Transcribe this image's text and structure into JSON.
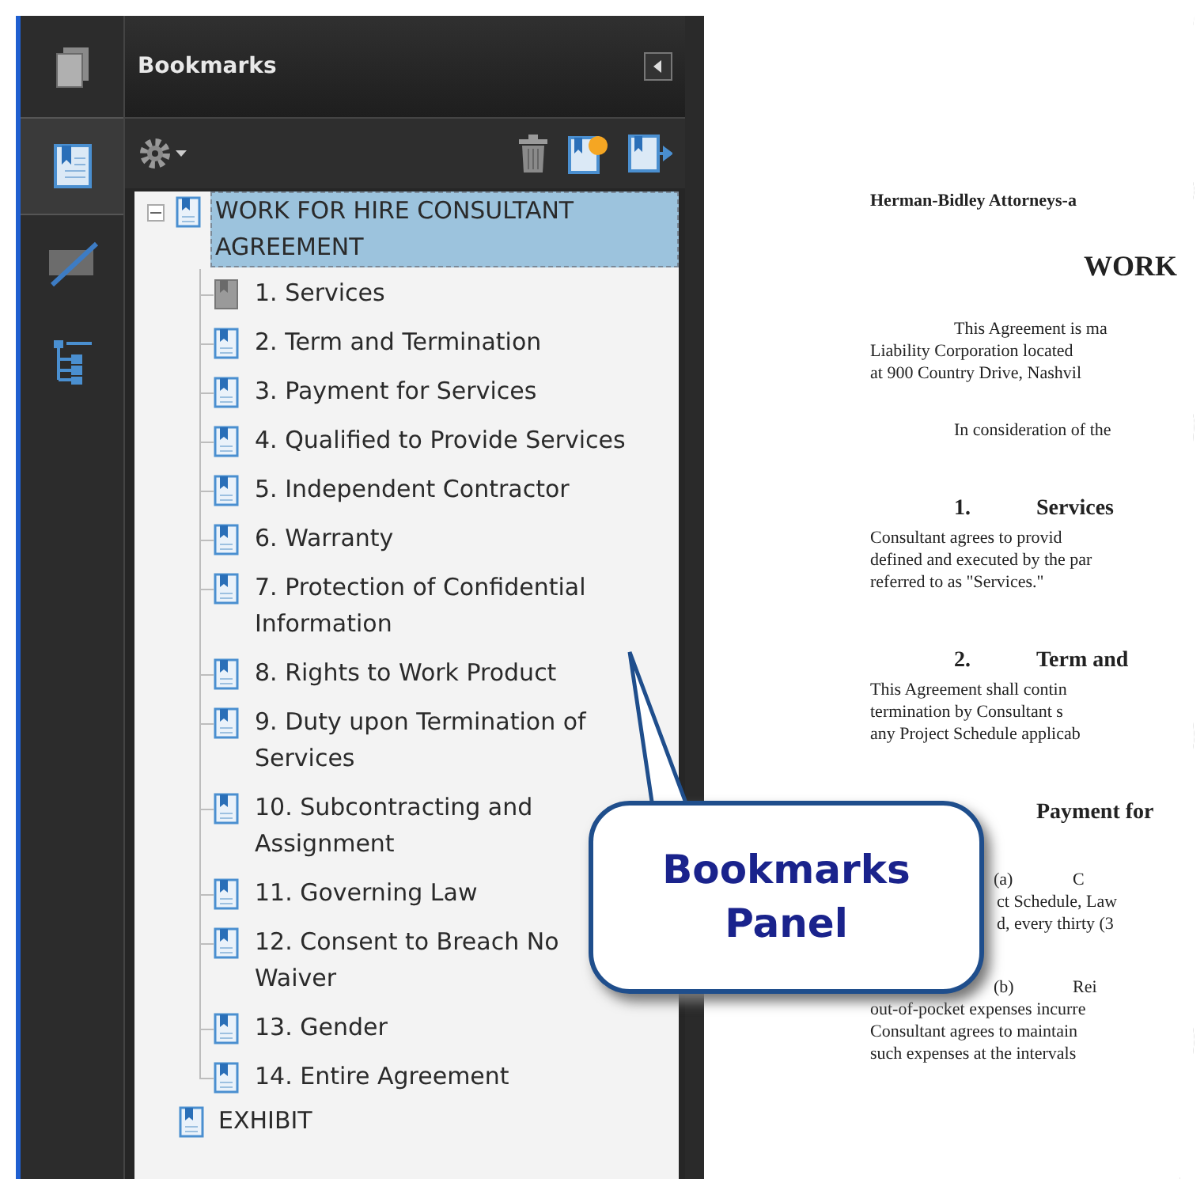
{
  "sidebar_tabs": [
    {
      "kind": "pages",
      "selected": false
    },
    {
      "kind": "bookmarks",
      "selected": true
    },
    {
      "kind": "signatures",
      "selected": false
    },
    {
      "kind": "structure",
      "selected": false
    }
  ],
  "panel": {
    "title": "Bookmarks"
  },
  "tree": [
    {
      "label": "WORK FOR HIRE CONSULTANT AGREEMENT",
      "selected": true,
      "expanded": true,
      "children": [
        {
          "label": "1. Services",
          "kind": "blank",
          "selected": false
        },
        {
          "label": "2. Term and Termination",
          "kind": "bookmark",
          "selected": false
        },
        {
          "label": "3. Payment for Services",
          "kind": "bookmark",
          "selected": false
        },
        {
          "label": "4. Qualified to Provide Services",
          "kind": "bookmark",
          "selected": false
        },
        {
          "label": "5. Independent Contractor",
          "kind": "bookmark",
          "selected": false
        },
        {
          "label": "6. Warranty",
          "kind": "bookmark",
          "selected": false
        },
        {
          "label": "7. Protection of Confidential Information",
          "kind": "bookmark",
          "selected": false
        },
        {
          "label": "8. Rights to Work Product",
          "kind": "bookmark",
          "selected": false
        },
        {
          "label": "9. Duty upon Termination of Services",
          "kind": "bookmark",
          "selected": false
        },
        {
          "label": "10. Subcontracting and Assignment",
          "kind": "bookmark",
          "selected": false
        },
        {
          "label": "11. Governing Law",
          "kind": "bookmark",
          "selected": false
        },
        {
          "label": "12. Consent to Breach No Waiver",
          "kind": "bookmark",
          "selected": false
        },
        {
          "label": "13. Gender",
          "kind": "bookmark",
          "selected": false
        },
        {
          "label": "14. Entire Agreement",
          "kind": "bookmark",
          "selected": false
        }
      ]
    },
    {
      "label": "EXHIBIT",
      "selected": false
    }
  ],
  "document": [
    {
      "kind": "header",
      "lines": [
        "Herman-Bidley Attorneys-a"
      ]
    },
    {
      "kind": "title",
      "lines": [
        "WORK"
      ]
    },
    {
      "kind": "para",
      "lines": [
        "This Agreement is ma",
        "Liability Corporation located",
        "at 900 Country Drive, Nashvil"
      ]
    },
    {
      "kind": "para",
      "lines": [
        "In consideration of the"
      ]
    },
    {
      "kind": "heading",
      "number": "1.",
      "lines": [
        "Services"
      ]
    },
    {
      "kind": "body",
      "lines": [
        "Consultant agrees to provid",
        "defined and executed by the par",
        "referred to as \"Services.\""
      ]
    },
    {
      "kind": "heading",
      "number": "2.",
      "lines": [
        "Term and"
      ]
    },
    {
      "kind": "body",
      "lines": [
        "This Agreement shall contin",
        "termination by Consultant s",
        "any Project Schedule applicab"
      ]
    },
    {
      "kind": "heading",
      "lines": [
        "Payment for"
      ]
    },
    {
      "kind": "item",
      "number": "(a)",
      "lines": [
        "C",
        "ct Schedule, Law",
        "d, every thirty (3"
      ]
    },
    {
      "kind": "item",
      "number": "(b)",
      "lines": [
        "Rei",
        "out-of-pocket expenses incurre",
        "Consultant agrees to maintain",
        "such expenses at the intervals"
      ]
    }
  ],
  "callout": {
    "text": "Bookmarks Panel"
  }
}
